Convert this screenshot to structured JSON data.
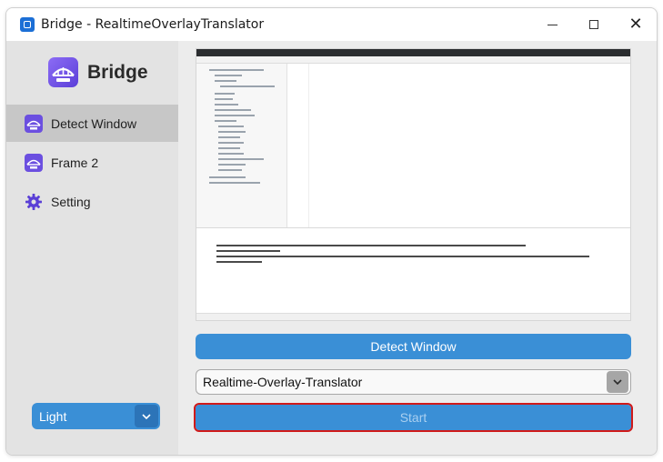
{
  "window": {
    "title": "Bridge - RealtimeOverlayTranslator"
  },
  "sidebar": {
    "app_name": "Bridge",
    "items": [
      {
        "label": "Detect Window",
        "icon": "bridge-icon",
        "active": true
      },
      {
        "label": "Frame 2",
        "icon": "bridge-icon",
        "active": false
      },
      {
        "label": "Setting",
        "icon": "gear-icon",
        "active": false
      }
    ],
    "theme": {
      "value": "Light"
    }
  },
  "main": {
    "detect_button": "Detect Window",
    "window_select": {
      "value": "Realtime-Overlay-Translator"
    },
    "start_button": "Start"
  },
  "colors": {
    "accent": "#3a8fd6",
    "accent_dark": "#2c74b8",
    "highlight_border": "#d01a1a",
    "brand_purple": "#6b4fe0"
  }
}
